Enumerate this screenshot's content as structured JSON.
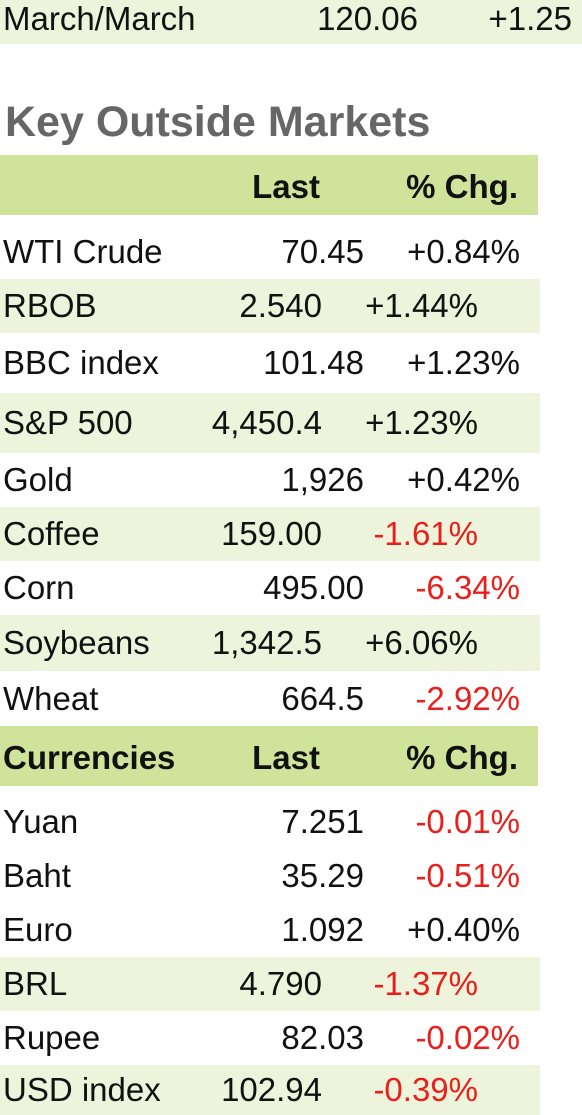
{
  "top_row": {
    "label": "March/March",
    "last": "120.06",
    "chg": "+1.25"
  },
  "title": "Key Outside Markets",
  "markets_header": {
    "label": "",
    "last": "Last",
    "chg": "% Chg."
  },
  "markets": [
    {
      "name": "WTI Crude",
      "last": "70.45",
      "chg": "+0.84%"
    },
    {
      "name": "RBOB",
      "last": "2.540",
      "chg": "+1.44%"
    },
    {
      "name": "BBC index",
      "last": "101.48",
      "chg": "+1.23%"
    },
    {
      "name": "S&P 500",
      "last": "4,450.4",
      "chg": "+1.23%"
    },
    {
      "name": "Gold",
      "last": "1,926",
      "chg": "+0.42%"
    },
    {
      "name": "Coffee",
      "last": "159.00",
      "chg": "-1.61%"
    },
    {
      "name": "Corn",
      "last": "495.00",
      "chg": "-6.34%"
    },
    {
      "name": "Soybeans",
      "last": "1,342.5",
      "chg": "+6.06%"
    },
    {
      "name": "Wheat",
      "last": "664.5",
      "chg": "-2.92%"
    }
  ],
  "currencies_header": {
    "label": "Currencies",
    "last": "Last",
    "chg": "% Chg."
  },
  "currencies": [
    {
      "name": "Yuan",
      "last": "7.251",
      "chg": "-0.01%"
    },
    {
      "name": "Baht",
      "last": "35.29",
      "chg": "-0.51%"
    },
    {
      "name": "Euro",
      "last": "1.092",
      "chg": "+0.40%"
    },
    {
      "name": "BRL",
      "last": "4.790",
      "chg": "-1.37%"
    },
    {
      "name": "Rupee",
      "last": "82.03",
      "chg": "-0.02%"
    },
    {
      "name": "USD index",
      "last": "102.94",
      "chg": "-0.39%"
    }
  ],
  "colors": {
    "negative": "#e8201c",
    "header_green": "#cfe39a",
    "row_alt": "#eef4db"
  }
}
